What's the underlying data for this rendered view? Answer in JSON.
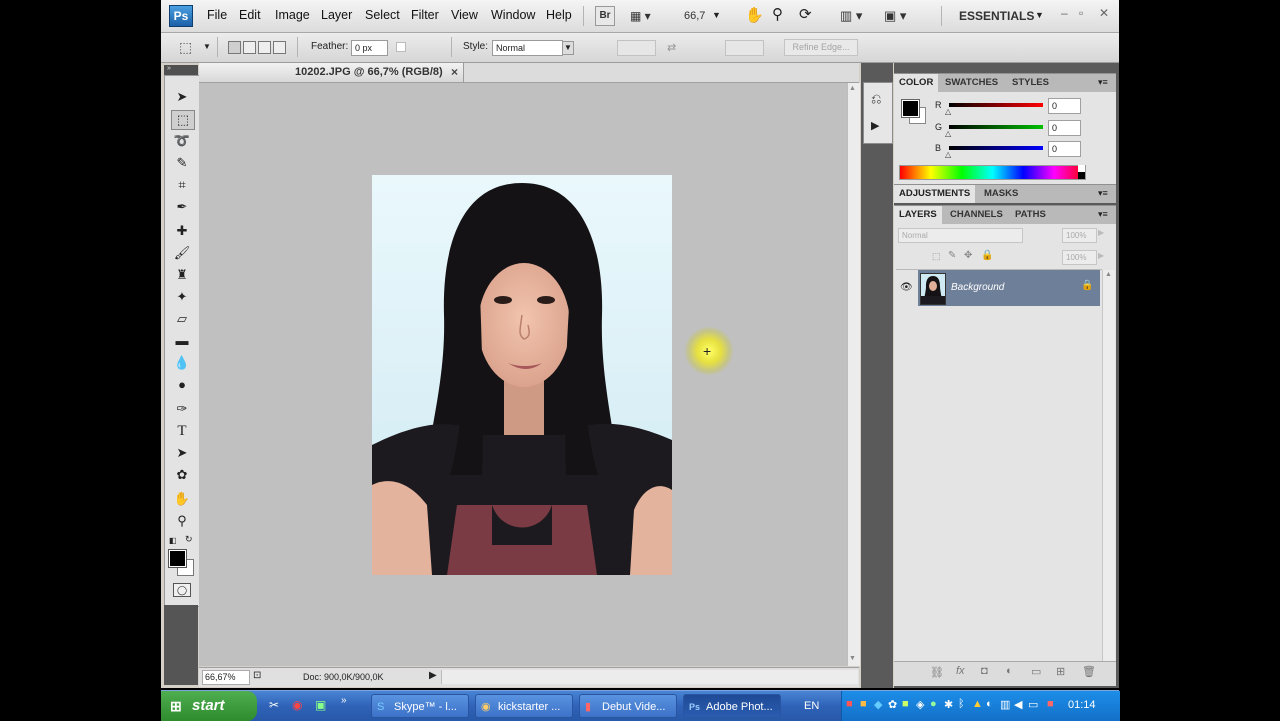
{
  "app": {
    "logo": "Ps",
    "menu": [
      "File",
      "Edit",
      "Image",
      "Layer",
      "Select",
      "Filter",
      "View",
      "Window",
      "Help"
    ],
    "bridge_label": "Br",
    "zoom": "66,7",
    "workspace": "ESSENTIALS",
    "window_controls": [
      "–",
      "▫",
      "✕"
    ]
  },
  "options": {
    "feather_label": "Feather:",
    "feather_value": "0 px",
    "style_label": "Style:",
    "style_value": "Normal",
    "refine_edge": "Refine Edge..."
  },
  "document": {
    "tab_title": "10202.JPG @ 66,7% (RGB/8)",
    "status_zoom": "66,67%",
    "status_doc": "Doc: 900,0K/900,0K"
  },
  "color_panel": {
    "tabs": [
      "COLOR",
      "SWATCHES",
      "STYLES"
    ],
    "channels": [
      {
        "label": "R",
        "value": "0",
        "color": "#ff0000"
      },
      {
        "label": "G",
        "value": "0",
        "color": "#00c000"
      },
      {
        "label": "B",
        "value": "0",
        "color": "#0000ff"
      }
    ]
  },
  "adjustments_panel": {
    "tabs": [
      "ADJUSTMENTS",
      "MASKS"
    ]
  },
  "layers_panel": {
    "tabs": [
      "LAYERS",
      "CHANNELS",
      "PATHS"
    ],
    "blend_mode": "Normal",
    "opacity": "100%",
    "fill": "100%",
    "layer_name": "Background"
  },
  "taskbar": {
    "start": "start",
    "tasks": [
      "Skype™ - l...",
      "kickstarter ...",
      "Debut Vide...",
      "Adobe Phot..."
    ],
    "language": "EN",
    "clock": "01:14"
  },
  "colors": {
    "accent_blue": "#1c5fa8",
    "cursor_highlight": "#ffff66"
  }
}
